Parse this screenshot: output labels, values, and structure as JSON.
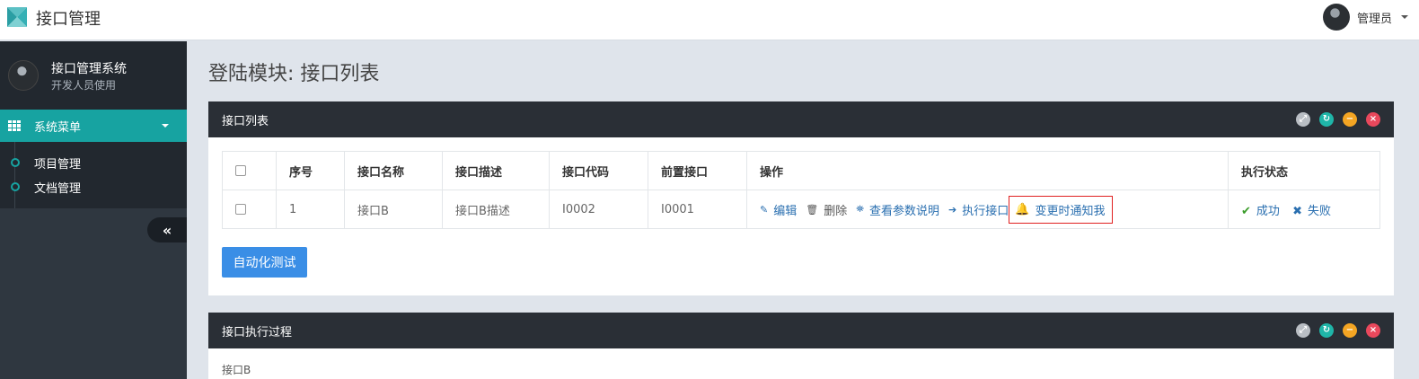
{
  "topbar": {
    "app_title": "接口管理",
    "user_name": "管理员"
  },
  "sidebar": {
    "profile_name": "接口管理系统",
    "profile_sub": "开发人员使用",
    "menu_title": "系统菜单",
    "items": [
      {
        "label": "项目管理"
      },
      {
        "label": "文档管理"
      }
    ],
    "collapse_glyph": "«"
  },
  "page": {
    "title": "登陆模块: 接口列表"
  },
  "panel_list": {
    "title": "接口列表",
    "columns": [
      "",
      "序号",
      "接口名称",
      "接口描述",
      "接口代码",
      "前置接口",
      "操作",
      "执行状态"
    ],
    "rows": [
      {
        "index": "1",
        "name": "接口B",
        "desc": "接口B描述",
        "code": "I0002",
        "prev": "I0001",
        "ops": {
          "edit": "编辑",
          "delete": "删除",
          "params": "查看参数说明",
          "execute": "执行接口",
          "notify": "变更时通知我"
        },
        "status": {
          "success": "成功",
          "fail": "失败"
        }
      }
    ],
    "auto_test_button": "自动化测试"
  },
  "panel_process": {
    "title": "接口执行过程",
    "body_text": "接口B"
  },
  "colors": {
    "accent_teal": "#17a3a1",
    "sidebar_dark": "#2f3740",
    "panel_header": "#2a2f36",
    "link_blue": "#2a6fb0",
    "primary_button": "#3a8ee6",
    "highlight_red": "#e02020"
  }
}
